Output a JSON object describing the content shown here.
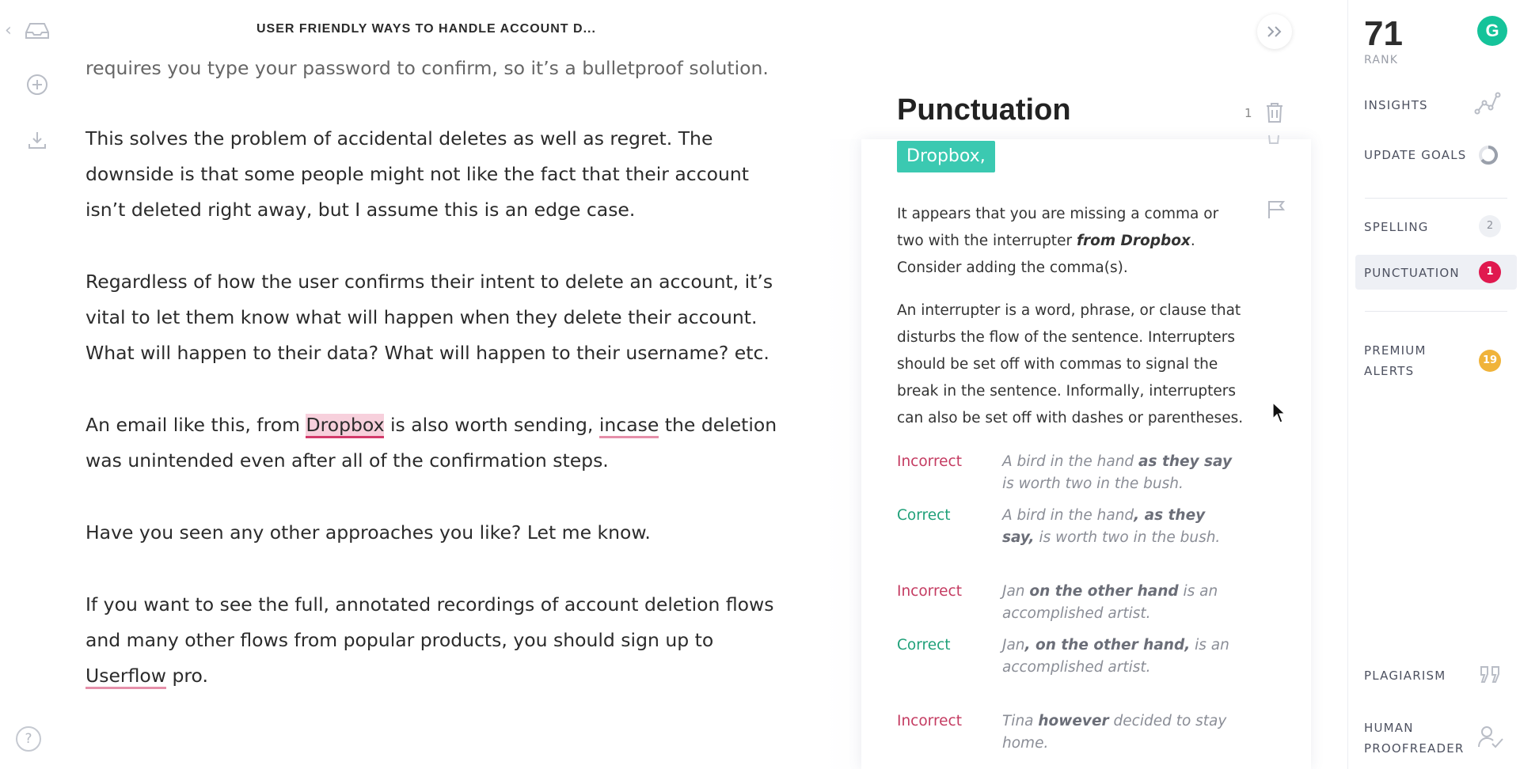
{
  "nav": {
    "back_icon": "chevron-left-icon",
    "inbox_icon": "inbox-icon",
    "add_icon": "plus-circle-icon",
    "download_icon": "download-icon",
    "help_label": "?"
  },
  "document": {
    "title": "USER FRIENDLY WAYS TO HANDLE ACCOUNT D...",
    "paragraphs": {
      "p0": "requires you type your password to confirm, so it’s a bulletproof solution.",
      "p1": "This solves the problem of accidental deletes as well as regret. The downside is that some people might not like the fact that their account isn’t deleted right away, but I assume this is an edge case.",
      "p2": "Regardless of how the user confirms their intent to delete an account, it’s vital to let them know what will happen when they delete their account. What will happen to their data? What will happen to their username? etc.",
      "p3_before": "An email like this, from ",
      "p3_highlight": "Dropbox",
      "p3_middle": " is also worth sending, ",
      "p3_underline": "incase",
      "p3_after": " the deletion was unintended even after all of the confirmation steps.",
      "p4": "Have you seen any other approaches you like? Let me know.",
      "p5_before": "If you want to see the full, annotated recordings of account deletion flows and many other flows from popular products, you should sign up to ",
      "p5_underline": "Userflow",
      "p5_after": " pro."
    }
  },
  "card": {
    "heading": "Punctuation",
    "count": "1",
    "suggestion_chip": "Dropbox,",
    "explanation": {
      "line1_a": "It appears that you are missing a comma or two with the interrupter ",
      "line1_bold": "from Dropbox",
      "line1_b": ". Consider adding the comma(s).",
      "para2": "An interrupter is a word, phrase, or clause that disturbs the flow of the sentence. Interrupters should be set off with commas to signal the break in the sentence. Informally, interrupters can also be set off with dashes or parentheses."
    },
    "examples": [
      {
        "label": "Incorrect",
        "pre": "A bird in the hand ",
        "bold": "as they say",
        "post": " is worth two in the bush."
      },
      {
        "label": "Correct",
        "pre": "A bird in the hand",
        "bold": ", as they say,",
        "post": " is worth two in the bush."
      },
      {
        "label": "Incorrect",
        "pre": "Jan ",
        "bold": "on the other hand",
        "post": " is an accomplished artist."
      },
      {
        "label": "Correct",
        "pre": "Jan",
        "bold": ", on the other hand,",
        "post": " is an accomplished artist."
      },
      {
        "label": "Incorrect",
        "pre": "Tina ",
        "bold": "however",
        "post": " decided to stay home."
      }
    ]
  },
  "sidebar": {
    "score": "71",
    "rank_label": "RANK",
    "logo_letter": "G",
    "insights": "INSIGHTS",
    "update_goals": "UPDATE GOALS",
    "spelling": "SPELLING",
    "spelling_count": "2",
    "punctuation": "PUNCTUATION",
    "punctuation_count": "1",
    "premium_line1": "PREMIUM",
    "premium_line2": "ALERTS",
    "premium_count": "19",
    "plagiarism": "PLAGIARISM",
    "proofreader_line1": "HUMAN",
    "proofreader_line2": "PROOFREADER"
  },
  "colors": {
    "accent_green": "#15c39a",
    "chip_teal": "#3bc9b1",
    "error_red": "#e0194f",
    "correct_green": "#21a17a",
    "premium_gold": "#f0b33a"
  }
}
